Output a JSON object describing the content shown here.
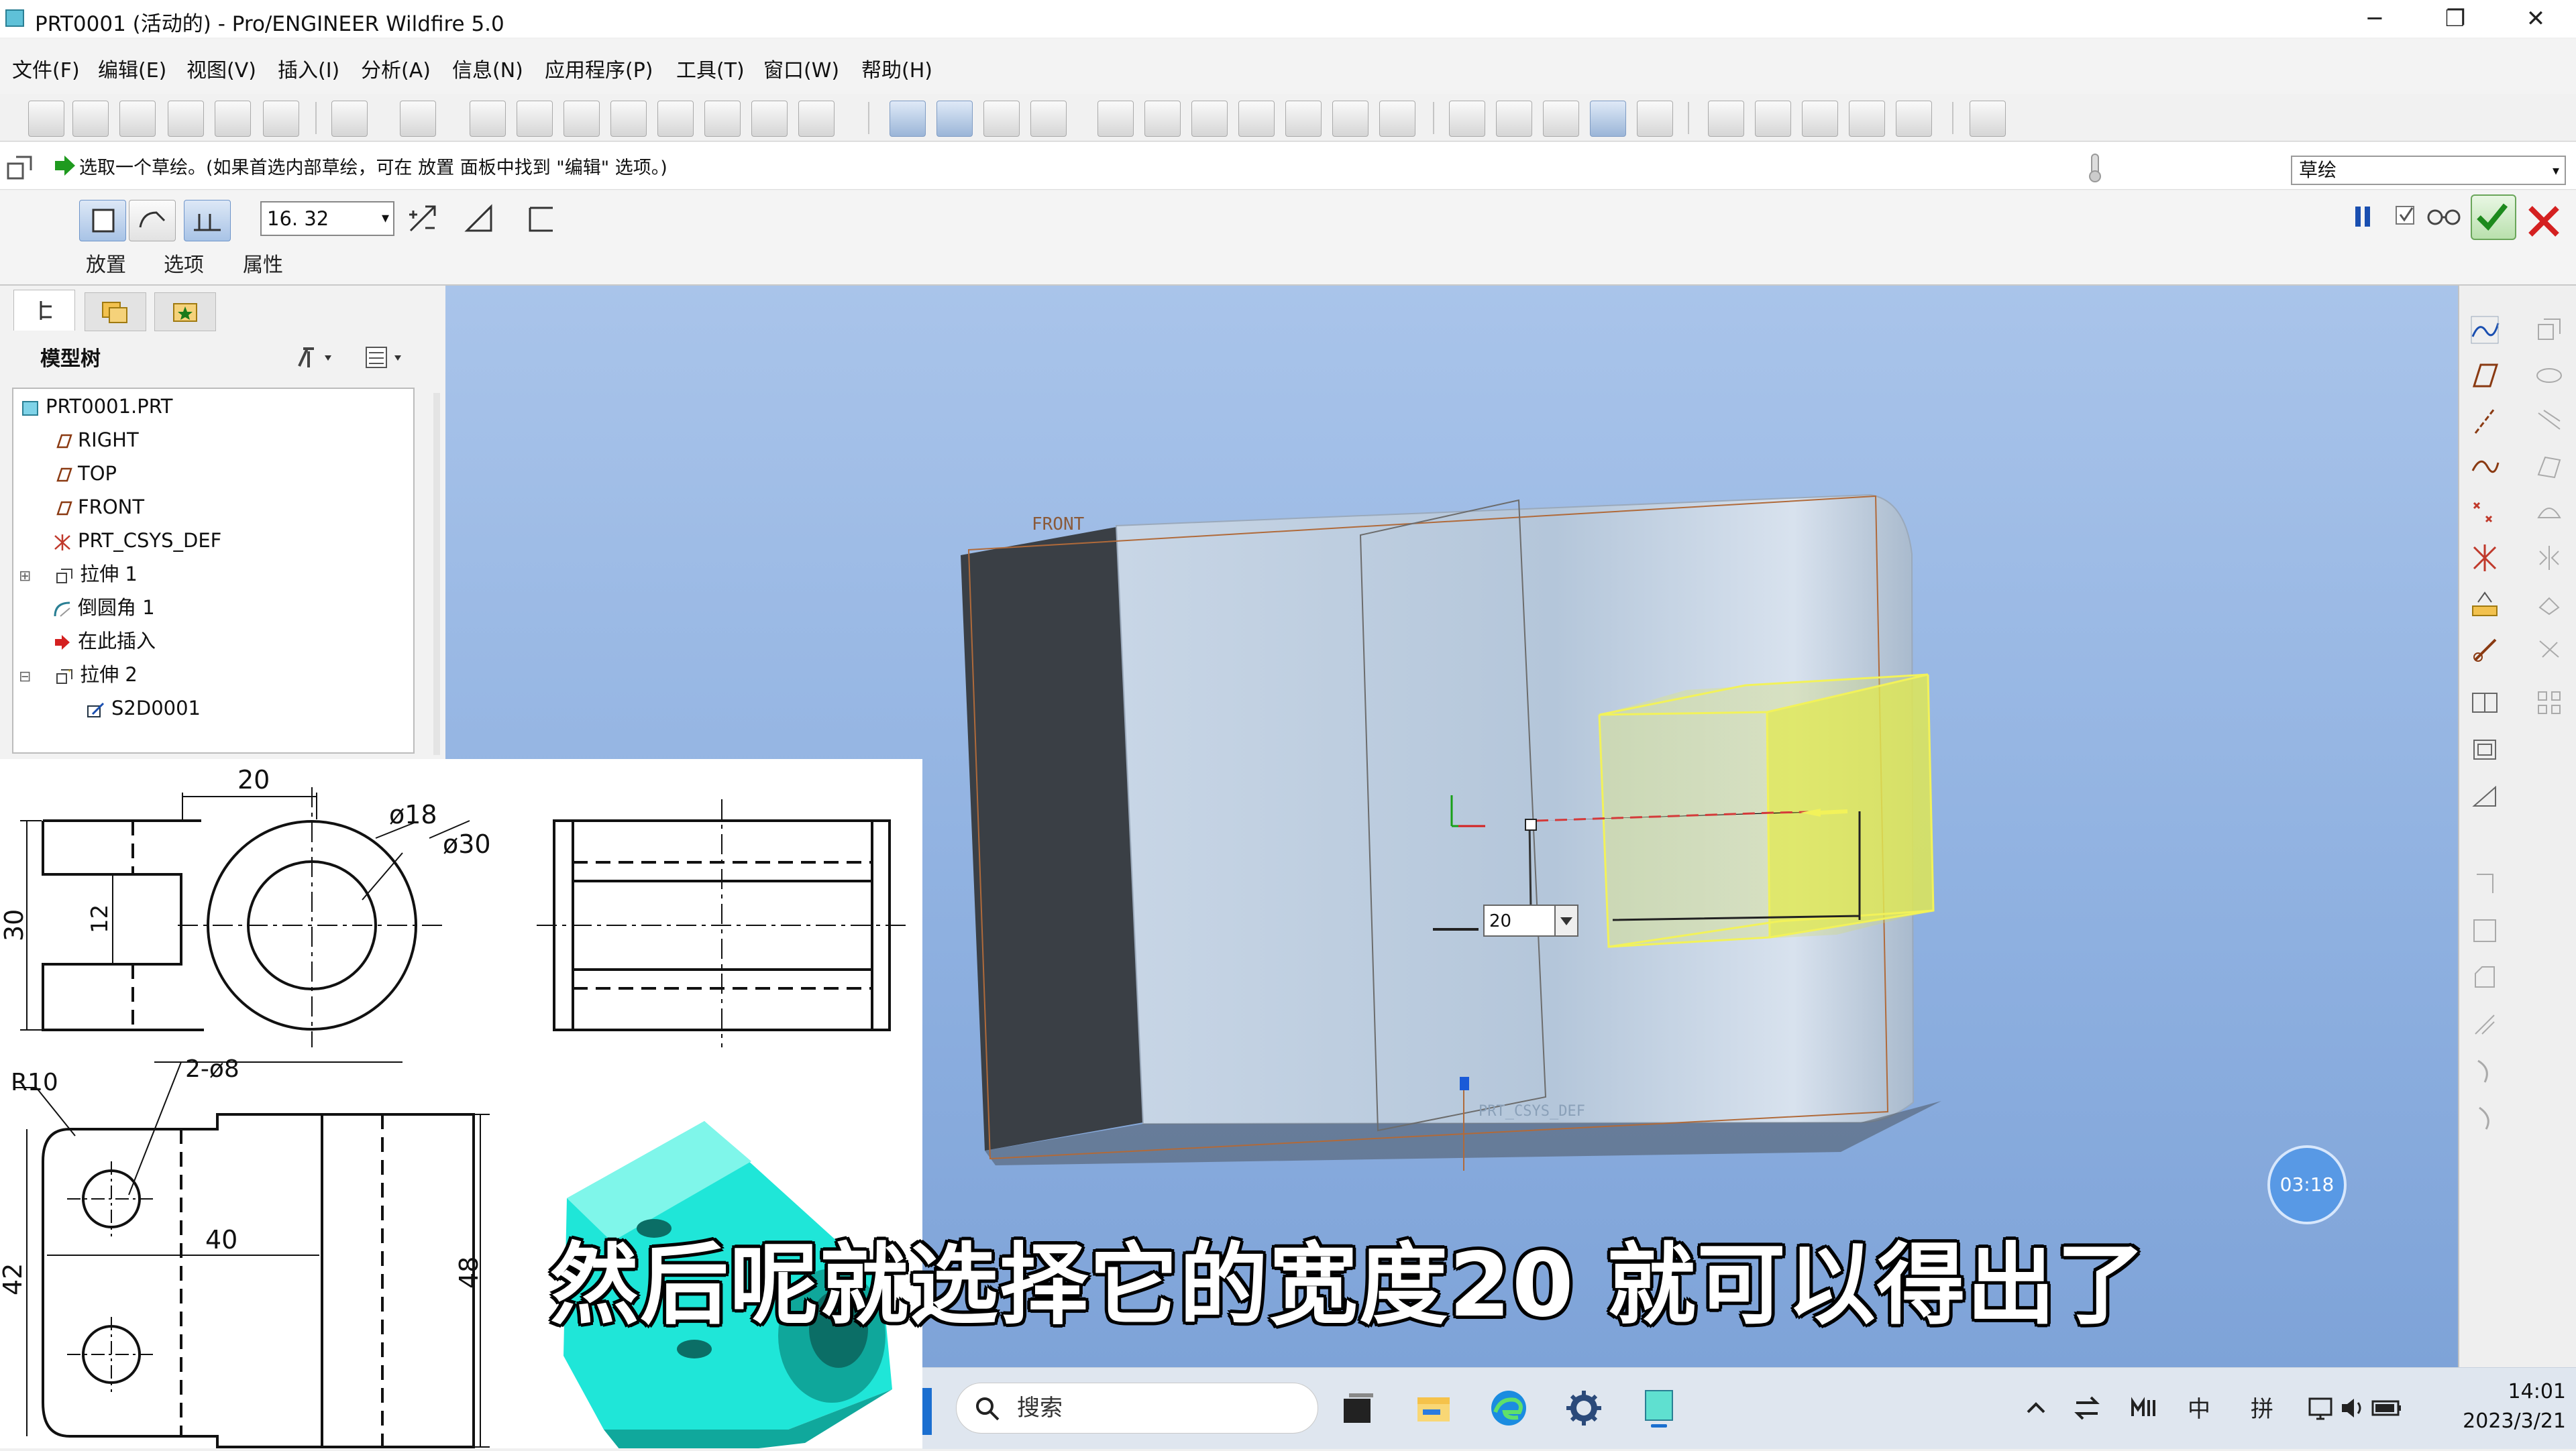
{
  "window": {
    "title": "PRT0001 (活动的) - Pro/ENGINEER Wildfire 5.0",
    "minimize": "─",
    "restore": "❐",
    "close": "✕"
  },
  "menu": [
    "文件(F)",
    "编辑(E)",
    "视图(V)",
    "插入(I)",
    "分析(A)",
    "信息(N)",
    "应用程序(P)",
    "工具(T)",
    "窗口(W)",
    "帮助(H)"
  ],
  "message": "选取一个草绘。(如果首选内部草绘，可在 放置 面板中找到 \"编辑\" 选项。)",
  "sketch_mode": "草绘",
  "dashboard": {
    "depth_value": "16. 32",
    "tabs": [
      "放置",
      "选项",
      "属性"
    ]
  },
  "model_tree": {
    "header": "模型树",
    "items": [
      "PRT0001.PRT",
      "RIGHT",
      "TOP",
      "FRONT",
      "PRT_CSYS_DEF",
      "拉伸 1",
      "倒圆角 1",
      "在此插入",
      "拉伸 2",
      "S2D0001"
    ]
  },
  "viewport": {
    "front_label": "FRONT",
    "csys_label": "PRT_CSYS_DEF",
    "dim_value": "20",
    "timer": "03:18"
  },
  "drawing": {
    "dims": [
      "20",
      "ø18",
      "ø30",
      "30",
      "12",
      "R10",
      "2-ø8",
      "40",
      "42",
      "48"
    ]
  },
  "subtitle": "然后呢就选择它的宽度20 就可以得出了",
  "taskbar": {
    "search_placeholder": "搜索",
    "ime_lang": "中",
    "ime_mode": "拼",
    "time": "14:01",
    "date": "2023/3/21"
  },
  "colors": {
    "viewport_top": "#a9c4ea",
    "preview_yellow": "#e8f060",
    "confirm_green": "#2e9a2e",
    "cancel_red": "#d42020",
    "part_cyan": "#1fe6d8"
  }
}
